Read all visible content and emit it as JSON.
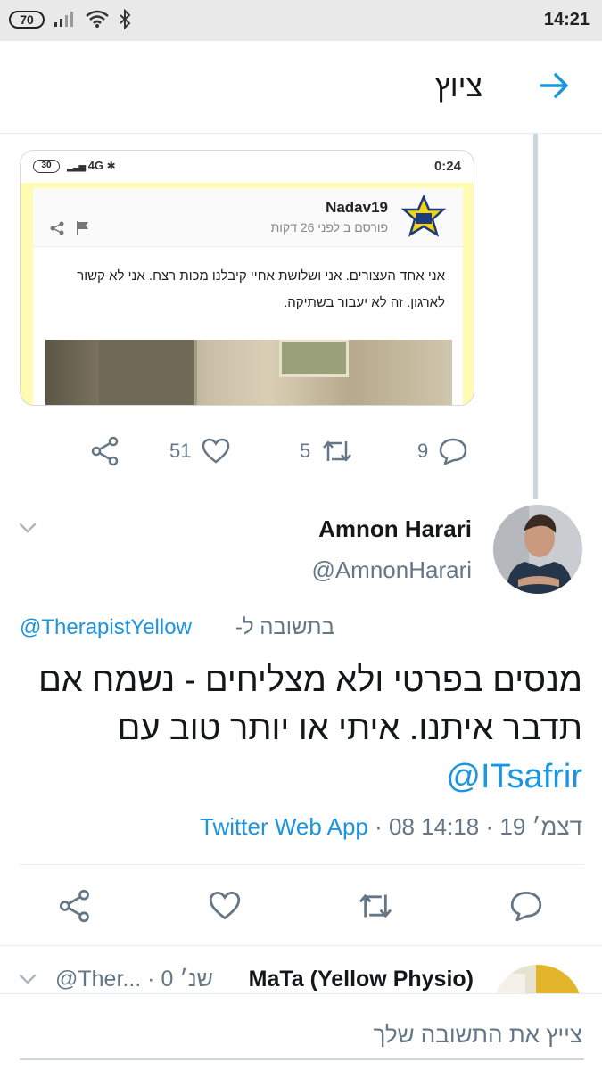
{
  "status_bar": {
    "battery": "70",
    "time": "14:21",
    "icons": [
      "signal-icon",
      "wifi-icon",
      "bluetooth-icon"
    ]
  },
  "header": {
    "title": "ציוץ",
    "back_icon": "arrow-right-icon"
  },
  "previous_tweet": {
    "embedded_screenshot": {
      "status_battery": "30",
      "status_network": "4G",
      "status_time": "0:24",
      "username": "Nadav19",
      "posted": "פורסם ב לפני 26 דקות",
      "text": "אני אחד העצורים. אני ושלושת אחיי קיבלנו מכות רצח.  אני לא קשור לארגון. זה לא יעבור בשתיקה."
    },
    "actions": {
      "replies": "9",
      "retweets": "5",
      "likes": "51"
    }
  },
  "main_tweet": {
    "display_name": "Amnon Harari",
    "handle": "@AmnonHarari",
    "reply_prefix": "בתשובה ל-",
    "reply_to": "@TherapistYellow",
    "text": "מנסים בפרטי ולא מצליחים - נשמח אם תדבר איתנו. איתי או יותר טוב עם",
    "mention": "@ITsafrir",
    "time": "14:18",
    "date": "08 דצמ׳ 19",
    "separator": "·",
    "source": "Twitter Web App"
  },
  "next_tweet": {
    "display_name": "MaTa (Yellow Physio)",
    "handle_and_time": "@Ther... · 0 שנ׳"
  },
  "reply_bar": {
    "placeholder": "צייץ את התשובה שלך"
  },
  "colors": {
    "accent": "#1b95e0",
    "muted": "#657786",
    "text": "#14171a",
    "divider": "#e6ecf0"
  }
}
